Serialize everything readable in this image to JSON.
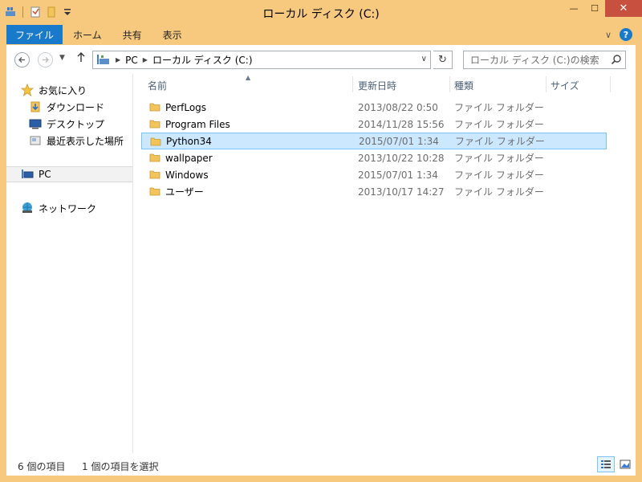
{
  "window": {
    "title": "ローカル ディスク (C:)",
    "accent_color": "#f7c97e",
    "close_color": "#c7503f"
  },
  "qat": {
    "icons": [
      "properties-icon",
      "new-folder-icon",
      "customize-dropdown-icon"
    ]
  },
  "window_buttons": {
    "minimize": "—",
    "maximize": "☐",
    "close": "✕"
  },
  "ribbon": {
    "tabs": [
      {
        "label": "ファイル"
      },
      {
        "label": "ホーム"
      },
      {
        "label": "共有"
      },
      {
        "label": "表示"
      }
    ],
    "help": "?",
    "expand": "∨"
  },
  "address": {
    "crumbs": [
      "PC",
      "ローカル ディスク (C:)"
    ]
  },
  "search": {
    "placeholder": "ローカル ディスク (C:)の検索"
  },
  "nav": {
    "favorites": "お気に入り",
    "downloads": "ダウンロード",
    "desktop": "デスクトップ",
    "recent": "最近表示した場所",
    "pc": "PC",
    "network": "ネットワーク"
  },
  "columns": {
    "name": "名前",
    "date": "更新日時",
    "type": "種類",
    "size": "サイズ"
  },
  "files": [
    {
      "name": "PerfLogs",
      "date": "2013/08/22 0:50",
      "type": "ファイル フォルダー",
      "size": ""
    },
    {
      "name": "Program Files",
      "date": "2014/11/28 15:56",
      "type": "ファイル フォルダー",
      "size": ""
    },
    {
      "name": "Python34",
      "date": "2015/07/01 1:34",
      "type": "ファイル フォルダー",
      "size": "",
      "selected": true
    },
    {
      "name": "wallpaper",
      "date": "2013/10/22 10:28",
      "type": "ファイル フォルダー",
      "size": ""
    },
    {
      "name": "Windows",
      "date": "2015/07/01 1:34",
      "type": "ファイル フォルダー",
      "size": ""
    },
    {
      "name": "ユーザー",
      "date": "2013/10/17 14:27",
      "type": "ファイル フォルダー",
      "size": ""
    }
  ],
  "status": {
    "count": "6 個の項目",
    "selected": "1 個の項目を選択"
  }
}
